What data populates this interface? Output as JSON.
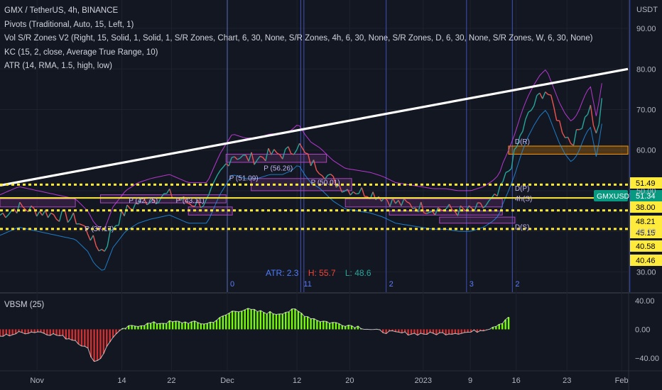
{
  "legend": {
    "symbol_line": "GMX / TetherUS, 4h, BINANCE",
    "indicators": [
      "Pivots (Traditional, Auto, 15, Left, 1)",
      "Vol S/R Zones V2 (Right, 15, Solid, 1, Solid, 1, S/R Zones, Chart, 6, 30, None, S/R Zones, 4h, 6, 30, None, S/R Zones, D, 6, 30, None, S/R Zones, W, 6, 30, None)",
      "KC (15, 2, close, Average True Range, 10)",
      "ATR (14, RMA, 1.5, high, low)"
    ]
  },
  "oscillator": {
    "label": "VBSM (25)",
    "ticks": [
      "40.00",
      "0.00",
      "−40.00"
    ],
    "tick_values": [
      40,
      0,
      -40
    ],
    "range": [
      -57,
      50
    ]
  },
  "stats": {
    "atr": "ATR: 2.3",
    "high": "H: 55.7",
    "low": "L: 48.6",
    "atr_color": "#4d7cff",
    "high_color": "#f44336",
    "low_color": "#26a69a"
  },
  "chart_data": {
    "type": "line",
    "title": "GMX / TetherUS, 4h, BINANCE",
    "y_axis_title": "USDT",
    "ylim": [
      25,
      97
    ],
    "xlim": [
      0,
      100
    ],
    "y_ticks": [
      30,
      40,
      50,
      60,
      70,
      80,
      90
    ],
    "y_tick_labels": [
      "30.00",
      "40.00",
      "50.00",
      "60.00",
      "70.00",
      "80.00",
      "90.00"
    ],
    "x_ticks": [
      {
        "label": "Nov",
        "x": 5.9
      },
      {
        "label": "14",
        "x": 19.4
      },
      {
        "label": "22",
        "x": 27.3
      },
      {
        "label": "Dec",
        "x": 36.2
      },
      {
        "label": "12",
        "x": 47.3
      },
      {
        "label": "20",
        "x": 55.7
      },
      {
        "label": "2023",
        "x": 67.4
      },
      {
        "label": "9",
        "x": 74.9
      },
      {
        "label": "16",
        "x": 82.2
      },
      {
        "label": "23",
        "x": 90.3
      },
      {
        "label": "Feb",
        "x": 99.0
      }
    ],
    "price_series": {
      "name": "GMXUSDT",
      "x": [
        0,
        3,
        6,
        9,
        12,
        14,
        15,
        16.5,
        18,
        20,
        22,
        24,
        27,
        30,
        33,
        35,
        37,
        39,
        41,
        43,
        45,
        46.5,
        47.5,
        48.5,
        49.5,
        51,
        53,
        55,
        57,
        59,
        61,
        63,
        65,
        67,
        69,
        71,
        73,
        75,
        77,
        78.5,
        79.5,
        80,
        81,
        82,
        83,
        84,
        85,
        86,
        87,
        88,
        89,
        90,
        91,
        91.5,
        92,
        93,
        94,
        95,
        96
      ],
      "y": [
        44,
        46,
        45,
        44,
        43,
        40,
        37,
        35,
        41,
        45,
        47,
        48,
        49,
        47,
        47,
        54,
        59,
        58,
        58,
        59,
        59,
        60,
        61.5,
        59,
        57,
        55.5,
        52.5,
        50.5,
        50,
        49.5,
        48.5,
        47,
        46.5,
        46,
        45.5,
        45.5,
        45,
        45,
        46,
        47.5,
        49,
        51.5,
        55,
        59,
        64,
        68,
        71,
        73.5,
        75,
        71,
        67,
        64,
        62,
        63,
        64,
        68,
        71,
        63,
        73
      ]
    },
    "trendline": {
      "x": [
        0,
        100
      ],
      "y": [
        51.3,
        80
      ]
    },
    "horizontal_levels": [
      {
        "value": 51.49,
        "label": "51.49",
        "style": "dotted",
        "color": "#ffeb3b"
      },
      {
        "value": 48.21,
        "label": "48.21",
        "style": "solid",
        "color": "#ffeb3b"
      },
      {
        "value": 45.15,
        "label": "45.15",
        "style": "dotted",
        "color": "#ffeb3b"
      },
      {
        "value": 40.58,
        "label": "40.58",
        "style": "dotted",
        "color": "#ffeb3b"
      },
      {
        "value": 40.46,
        "label": "40.46",
        "style": "none",
        "color": "#ffeb3b"
      },
      {
        "value": 38.0,
        "label": "38.00",
        "style": "none",
        "color": "#ffeb3b"
      }
    ],
    "last_price": {
      "label": "GMXUSDT",
      "value": 51.34,
      "value_label": "51.34",
      "color": "#089981"
    },
    "orange_zone": {
      "from": 59,
      "to": 61,
      "x_from": 81,
      "x_to": 100
    },
    "pivot_labels": [
      {
        "text": "P (42.75)",
        "x": 20.5,
        "y": 47
      },
      {
        "text": "P (43.11)",
        "x": 28,
        "y": 47
      },
      {
        "text": "P (37.17)",
        "x": 13.5,
        "y": 40
      },
      {
        "text": "P (51.09)",
        "x": 36.5,
        "y": 52.5
      },
      {
        "text": "P (56.26)",
        "x": 42,
        "y": 55
      },
      {
        "text": "P (50.01)",
        "x": 49.5,
        "y": 51.5
      },
      {
        "text": "D(R)",
        "x": 82,
        "y": 61.5
      },
      {
        "text": "D(P)",
        "x": 82,
        "y": 50
      },
      {
        "text": "4h(S)",
        "x": 82,
        "y": 47.5
      },
      {
        "text": "D(S)",
        "x": 82,
        "y": 40.5
      }
    ],
    "session_lines": [
      {
        "x": 36.2,
        "label": "0",
        "color": "#5b6cb8"
      },
      {
        "x": 47.9,
        "label": "11",
        "color": "#3f51b5"
      },
      {
        "x": 48.4,
        "label": "",
        "color": "#3f51b5"
      },
      {
        "x": 61.5,
        "label": "2",
        "color": "#3f51b5"
      },
      {
        "x": 74.3,
        "label": "3",
        "color": "#3f51b5"
      },
      {
        "x": 81.6,
        "label": "2",
        "color": "#3f51b5"
      },
      {
        "x": 100.3,
        "label": "",
        "color": "#3f51b5"
      }
    ],
    "oscillator_series": {
      "name": "VBSM (25)",
      "x": [
        0,
        3,
        6,
        9,
        12,
        14,
        15,
        16,
        18,
        20,
        22,
        24,
        27,
        30,
        33,
        35,
        37,
        39,
        41,
        44,
        47,
        49,
        51,
        54,
        57,
        60,
        63,
        66,
        69,
        72,
        75,
        78,
        80,
        81
      ],
      "y": [
        -10,
        -5,
        -3,
        -8,
        -15,
        -28,
        -45,
        -40,
        -10,
        2,
        6,
        8,
        10,
        10,
        8,
        15,
        25,
        28,
        25,
        22,
        27,
        18,
        12,
        8,
        4,
        -2,
        -5,
        -6,
        -6,
        -5,
        -4,
        2,
        10,
        18
      ]
    },
    "colors": {
      "price_up": "#26a69a",
      "price_down": "#ef5350",
      "trendline": "#ffffff",
      "kc_upper": "#e040fb",
      "kc_lower": "#2196f3",
      "osc_positive": "#76ff03",
      "osc_negative": "#d32f2f",
      "osc_line": "#ffffff"
    }
  }
}
